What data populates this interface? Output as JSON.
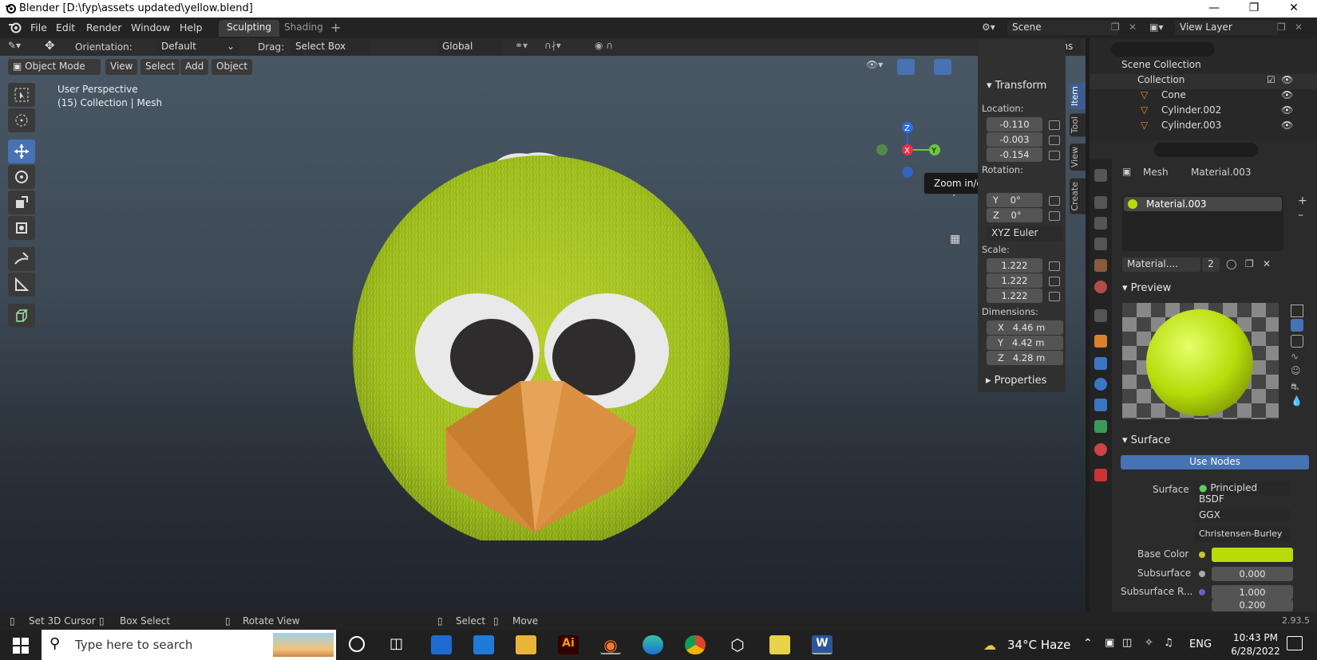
{
  "window": {
    "title": "Blender [D:\\fyp\\assets updated\\yellow.blend]"
  },
  "menu": [
    "File",
    "Edit",
    "Render",
    "Window",
    "Help"
  ],
  "workspaces": [
    "Sculpting",
    "Shading"
  ],
  "scene": {
    "label": "Scene",
    "view_layer": "View Layer"
  },
  "header": {
    "orientation_label": "Orientation:",
    "orientation_value": "Default",
    "drag_label": "Drag:",
    "drag_value": "Select Box",
    "transform_orientation": "Global",
    "options": "Options"
  },
  "viewport": {
    "mode": "Object Mode",
    "menus": [
      "View",
      "Select",
      "Add",
      "Object"
    ],
    "perspective": "User Perspective",
    "collection_info": "(15) Collection | Mesh",
    "tooltip": "Zoom in/out in the view",
    "gizmo": {
      "x": "X",
      "y": "Y",
      "z": "Z"
    }
  },
  "npanel": {
    "transform_title": "Transform",
    "location_label": "Location:",
    "location": [
      "-0.110",
      "-0.003",
      "-0.154"
    ],
    "rotation_label": "Rotation:",
    "rotation": [
      {
        "axis": "Y",
        "value": "0°"
      },
      {
        "axis": "Z",
        "value": "0°"
      }
    ],
    "rotation_mode": "XYZ Euler",
    "scale_label": "Scale:",
    "scale": [
      "1.222",
      "1.222",
      "1.222"
    ],
    "dimensions_label": "Dimensions:",
    "dimensions": [
      {
        "axis": "X",
        "value": "4.46 m"
      },
      {
        "axis": "Y",
        "value": "4.42 m"
      },
      {
        "axis": "Z",
        "value": "4.28 m"
      }
    ],
    "properties_title": "Properties",
    "tabs": [
      "Item",
      "Tool",
      "View",
      "Create"
    ]
  },
  "outliner": {
    "scene_collection": "Scene Collection",
    "collection": "Collection",
    "items": [
      "Cone",
      "Cylinder.002",
      "Cylinder.003"
    ]
  },
  "properties": {
    "breadcrumb_mesh": "Mesh",
    "breadcrumb_material": "Material.003",
    "slot": "Material.003",
    "material_name": "Material....",
    "users": "2",
    "preview_title": "Preview",
    "surface_title": "Surface",
    "use_nodes": "Use Nodes",
    "surface_label": "Surface",
    "surface_value": "Principled BSDF",
    "distribution": "GGX",
    "subsurface_method": "Christensen-Burley",
    "base_color_label": "Base Color",
    "base_color": "#b8dc0a",
    "subsurface_label": "Subsurface",
    "subsurface_value": "0.000",
    "subsurface_r_label": "Subsurface R...",
    "subsurface_r_values": [
      "1.000",
      "0.200"
    ]
  },
  "statusbar": {
    "items": [
      "Set 3D Cursor",
      "Box Select",
      "Rotate View",
      "Select",
      "Move"
    ],
    "version": "2.93.5"
  },
  "taskbar": {
    "search_placeholder": "Type here to search",
    "weather": "34°C  Haze",
    "language": "ENG",
    "time": "10:43 PM",
    "date": "6/28/2022"
  }
}
